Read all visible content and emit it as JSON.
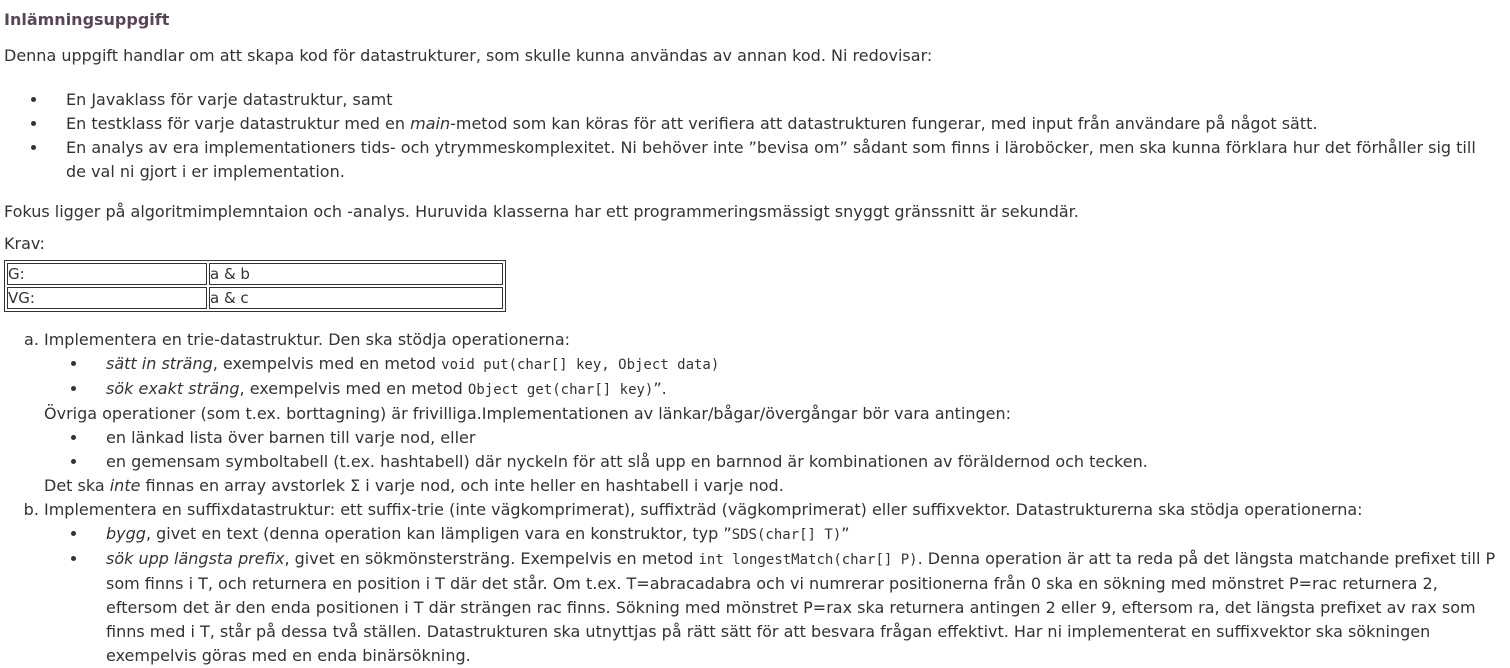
{
  "heading": "Inlämningsuppgift",
  "intro": "Denna uppgift handlar om att skapa kod för datastrukturer, som skulle kunna användas av annan kod. Ni redovisar:",
  "deliverables": {
    "item1": "En Javaklass för varje datastruktur, samt",
    "item2_pre": "En testklass för varje datastruktur med en ",
    "item2_em": "main",
    "item2_post": "-metod som kan köras för att verifiera att datastrukturen fungerar, med input från användare på något sätt.",
    "item3": "En analys av era implementationers tids- och ytrymmeskomplexitet. Ni behöver inte ”bevisa om” sådant som finns i läroböcker, men ska kunna förklara hur det förhåller sig till de val ni gjort i er implementation."
  },
  "focus": "Fokus ligger på algoritmimplemntaion och -analys. Huruvida klasserna har ett programmeringsmässigt snyggt gränssnitt är sekundär.",
  "krav_label": "Krav:",
  "grade_table": [
    {
      "grade": "G:",
      "req": "a & b"
    },
    {
      "grade": "VG:",
      "req": "a & c"
    }
  ],
  "task_a": {
    "intro": "Implementera en trie-datastruktur. Den ska stödja operationerna:",
    "op1_em": "sätt in sträng",
    "op1_text": ", exempelvis med en metod ",
    "op1_code": "void put(char[] key, Object data)",
    "op2_em": "sök exakt sträng",
    "op2_text": ", exempelvis med en metod ",
    "op2_code": "Object get(char[] key)",
    "op2_tail": "”.",
    "other_ops": "Övriga operationer (som t.ex. borttagning) är frivilliga.Implementationen av länkar/bågar/övergångar bör vara antingen:",
    "opt1": "en länkad lista över barnen till varje nod, eller",
    "opt2": "en gemensam symboltabell (t.ex. hashtabell) där nyckeln för att slå upp en barnnod är kombinationen av föräldernod och tecken.",
    "note_pre": "Det ska ",
    "note_em": "inte",
    "note_post": " finnas en array avstorlek Σ i varje nod, och inte heller en hashtabell i varje nod."
  },
  "task_b": {
    "intro": "Implementera en suffixdatastruktur: ett suffix-trie (inte vägkomprimerat), suffixträd (vägkomprimerat) eller suffixvektor. Datastrukturerna ska stödja operationerna:",
    "op1_em": "bygg",
    "op1_text": ", givet en text (denna operation kan lämpligen vara en konstruktor, typ ”",
    "op1_code": "SDS(char[] T)",
    "op1_tail": "”",
    "op2_em": "sök upp längsta prefix",
    "op2_text": ", givet en sökmönstersträng. Exempelvis en metod ",
    "op2_code": "int longestMatch(char[] P)",
    "op2_tail": ". Denna operation är att ta reda på det längsta matchande prefixet till P som finns i T, och returnera en position i T där det står. Om t.ex. T=abracadabra och vi numrerar positionerna från 0 ska en sökning med mönstret P=rac returnera 2, eftersom det är den enda positionen i T där strängen rac finns. Sökning med mönstret P=rax ska returnera antingen 2 eller 9, eftersom ra, det längsta prefixet av rax som finns med i T, står på dessa två ställen. Datastrukturen ska utnyttjas på rätt sätt för att besvara frågan effektivt. Har ni implementerat en suffixvektor ska sökningen exempelvis göras med en enda binärsökning."
  }
}
